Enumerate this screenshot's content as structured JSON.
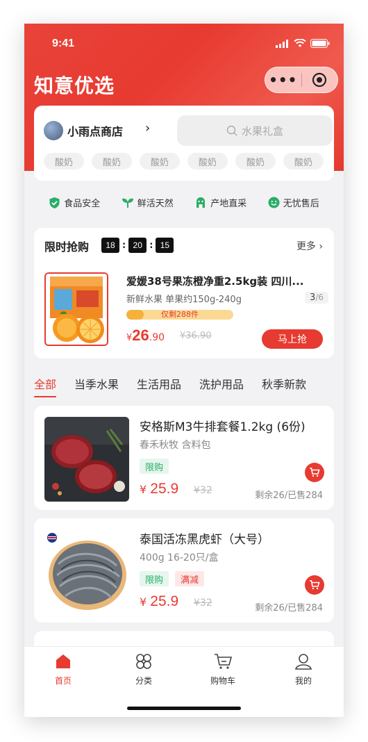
{
  "status": {
    "time": "9:41"
  },
  "header": {
    "title": "知意优选",
    "capsule_menu": "•••"
  },
  "store": {
    "name": "小雨点商店",
    "search_placeholder": "水果礼盒",
    "tags": [
      "酸奶",
      "酸奶",
      "酸奶",
      "酸奶",
      "酸奶",
      "酸奶"
    ]
  },
  "features": [
    {
      "label": "食品安全",
      "icon": "shield-check-icon"
    },
    {
      "label": "鲜活天然",
      "icon": "sprout-icon"
    },
    {
      "label": "产地直采",
      "icon": "shop-icon"
    },
    {
      "label": "无忧售后",
      "icon": "smile-icon"
    }
  ],
  "flash": {
    "title": "限时抢购",
    "countdown": {
      "h": "18",
      "m": "20",
      "s": "15"
    },
    "more": "更多",
    "product": {
      "name": "爱媛38号果冻橙净重2.5kg装 四川...",
      "sub": "新鲜水果 单果约150g-240g",
      "stock_current": "3",
      "stock_total": "/6",
      "progress_fraction": 0.16,
      "progress_text": "仅剩288件",
      "price_symbol": "¥",
      "price_int": "26",
      "price_dec": ".90",
      "old_price": "¥36.90",
      "buy_label": "马上抢"
    }
  },
  "categories": [
    "全部",
    "当季水果",
    "生活用品",
    "洗护用品",
    "秋季新款"
  ],
  "products": [
    {
      "name": "安格斯M3牛排套餐1.2kg (6份)",
      "sub": "春禾秋牧 含料包",
      "badges": [
        "限购"
      ],
      "price_symbol": "¥",
      "price": "25.9",
      "old_price": "¥32",
      "stock": "剩余26/已售284"
    },
    {
      "name": "泰国活冻黑虎虾（大号）",
      "sub": "400g 16-20只/盒",
      "badges": [
        "限购",
        "满减"
      ],
      "price_symbol": "¥",
      "price": "25.9",
      "old_price": "¥32",
      "stock": "剩余26/已售284"
    }
  ],
  "tabbar": [
    {
      "label": "首页",
      "icon": "home-icon"
    },
    {
      "label": "分类",
      "icon": "category-icon"
    },
    {
      "label": "购物车",
      "icon": "cart-icon"
    },
    {
      "label": "我的",
      "icon": "user-icon"
    }
  ],
  "colors": {
    "brand_red": "#e73a30",
    "green": "#2aad67",
    "progress_bg": "#fbd993",
    "progress_fill": "#f6b13b"
  }
}
